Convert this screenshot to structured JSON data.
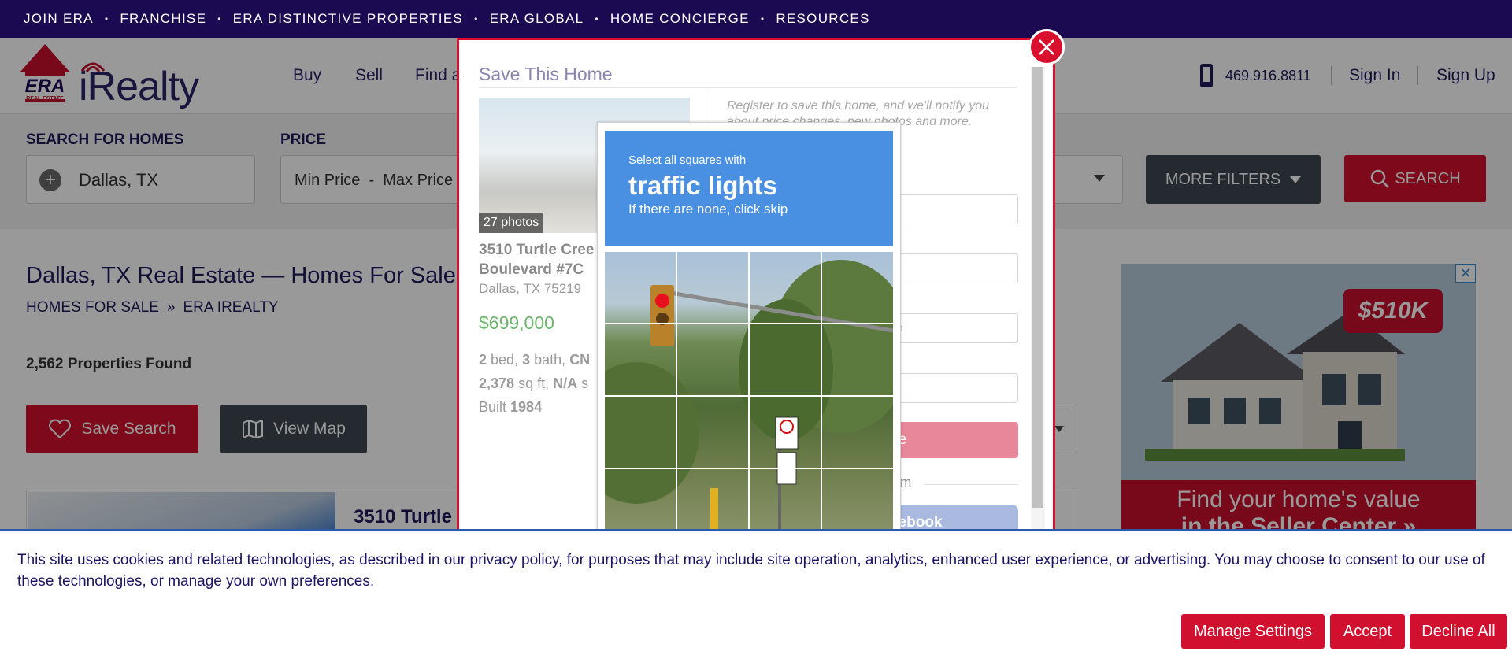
{
  "topbar": {
    "items": [
      "JOIN ERA",
      "FRANCHISE",
      "ERA DISTINCTIVE PROPERTIES",
      "ERA GLOBAL",
      "HOME CONCIERGE",
      "RESOURCES"
    ]
  },
  "header": {
    "logo_era": "ERA",
    "logo_era_sub": "REAL ESTATE",
    "logo_irealty": "iRealty",
    "nav": [
      "Buy",
      "Sell",
      "Find a"
    ],
    "phone": "469.916.8811",
    "sign_in": "Sign In",
    "sign_up": "Sign Up"
  },
  "search": {
    "location_label": "SEARCH FOR HOMES",
    "location_value": "Dallas, TX",
    "price_label": "PRICE",
    "price_value": "Min Price  -  Max Price",
    "more_filters": "MORE FILTERS",
    "search_button": "SEARCH"
  },
  "main": {
    "page_title": "Dallas, TX Real Estate — Homes For Sale",
    "breadcrumb": [
      "HOMES FOR SALE",
      "ERA IREALTY"
    ],
    "breadcrumb_sep": "»",
    "count": "2,562 Properties Found",
    "save_search": "Save Search",
    "view_map": "View Map",
    "listing_title": "3510 Turtle"
  },
  "ad": {
    "price": "$510K",
    "caption_1": "Find your home's value",
    "caption_2": "in the Seller Center »"
  },
  "modal": {
    "title": "Save This Home",
    "photos": "27 photos",
    "address_1": "3510 Turtle Cree",
    "address_2": "Boulevard #7C",
    "city": "Dallas, TX 75219",
    "price": "$699,000",
    "beds": "2",
    "beds_unit": "bed,",
    "baths": "3",
    "baths_unit": "bath,",
    "cn": "CN",
    "sqft": "2,378",
    "sqft_unit": "sq ft,",
    "na": "N/A",
    "na_unit": "s",
    "built_label": "Built",
    "built_year": "1984",
    "register_text_1": "Register to save this home, and we'll notify you",
    "register_text_2": "about price changes, new photos and more.",
    "field_hint": "m",
    "submit_partial": "ne",
    "or_partial": "orm",
    "facebook_partial": "cebook"
  },
  "captcha": {
    "line1": "Select all squares with",
    "line2": "traffic lights",
    "line3": "If there are none, click skip"
  },
  "cookie": {
    "text": "This site uses cookies and related technologies, as described in our privacy policy, for purposes that may include site operation, analytics, enhanced user experience, or advertising. You may choose to consent to our use of these technologies, or manage your own preferences.",
    "manage": "Manage Settings",
    "accept": "Accept",
    "decline": "Decline All"
  },
  "colors": {
    "brand_red": "#d0102e",
    "brand_navy": "#1b0a52",
    "captcha_blue": "#4a90e2",
    "price_green": "#3a9b3a"
  }
}
